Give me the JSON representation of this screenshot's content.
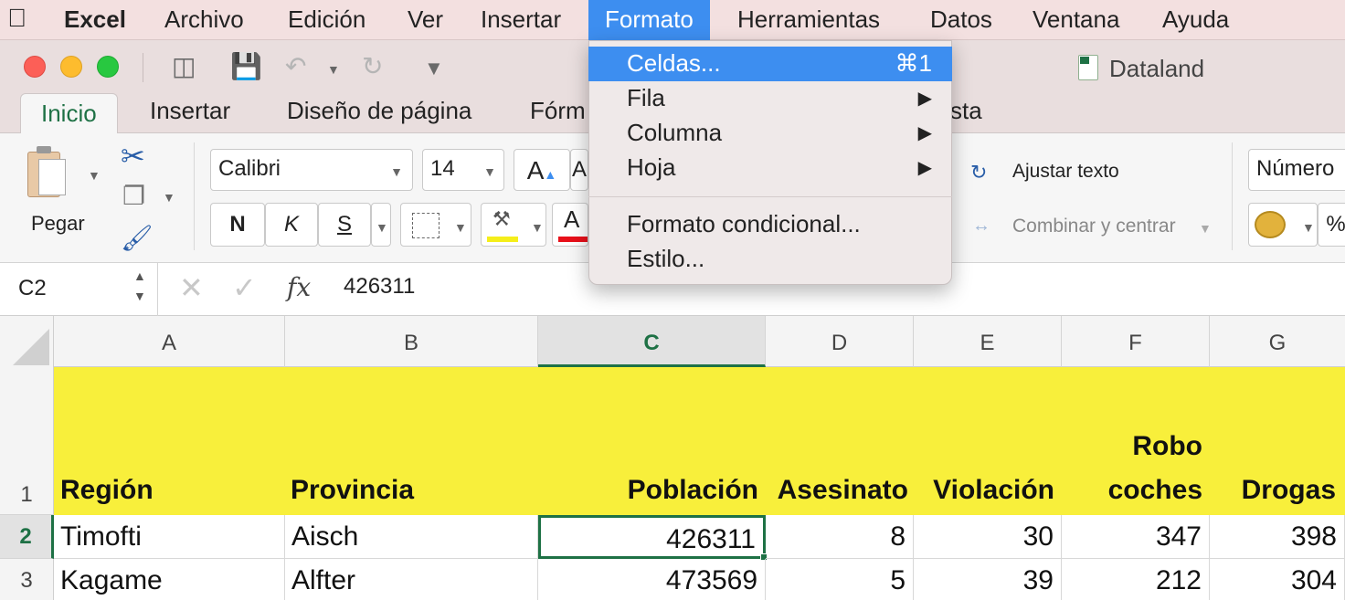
{
  "menubar": {
    "app": "Excel",
    "items": [
      "Archivo",
      "Edición",
      "Ver",
      "Insertar",
      "Formato",
      "Herramientas",
      "Datos",
      "Ventana",
      "Ayuda"
    ],
    "active": "Formato"
  },
  "window": {
    "title": "Dataland"
  },
  "ribbon": {
    "tabs": [
      "Inicio",
      "Insertar",
      "Diseño de página",
      "Fórm",
      "sta"
    ],
    "active_tab": "Inicio",
    "paste_label": "Pegar",
    "font_name": "Calibri",
    "font_size": "14",
    "grow_font": "A",
    "shrink_font": "A",
    "bold": "N",
    "italic": "K",
    "underline": "S",
    "font_color_letter": "A",
    "wrap_text": "Ajustar texto",
    "merge_center": "Combinar y centrar",
    "number_format": "Número",
    "percent": "%"
  },
  "formula_bar": {
    "name_box": "C2",
    "fx": "fx",
    "value": "426311"
  },
  "dropdown": {
    "items": [
      {
        "label": "Celdas...",
        "shortcut": "⌘1",
        "highlighted": true
      },
      {
        "label": "Fila",
        "submenu": "▶"
      },
      {
        "label": "Columna",
        "submenu": "▶"
      },
      {
        "label": "Hoja",
        "submenu": "▶"
      },
      {
        "label": "Formato condicional..."
      },
      {
        "label": "Estilo..."
      }
    ]
  },
  "sheet": {
    "columns": [
      "A",
      "B",
      "C",
      "D",
      "E",
      "F",
      "G"
    ],
    "selected_column": "C",
    "rows": [
      "1",
      "2",
      "3"
    ],
    "selected_row": "2",
    "header": [
      "Región",
      "Provincia",
      "Población",
      "Asesinato",
      "Violación",
      "Robo",
      "coches",
      "Drogas"
    ],
    "data": [
      [
        "Timofti",
        "Aisch",
        "426311",
        "8",
        "30",
        "347",
        "398"
      ],
      [
        "Kagame",
        "Alfter",
        "473569",
        "5",
        "39",
        "212",
        "304"
      ]
    ],
    "header_fill": "#f8ef3b",
    "accent": "#1e7145"
  }
}
